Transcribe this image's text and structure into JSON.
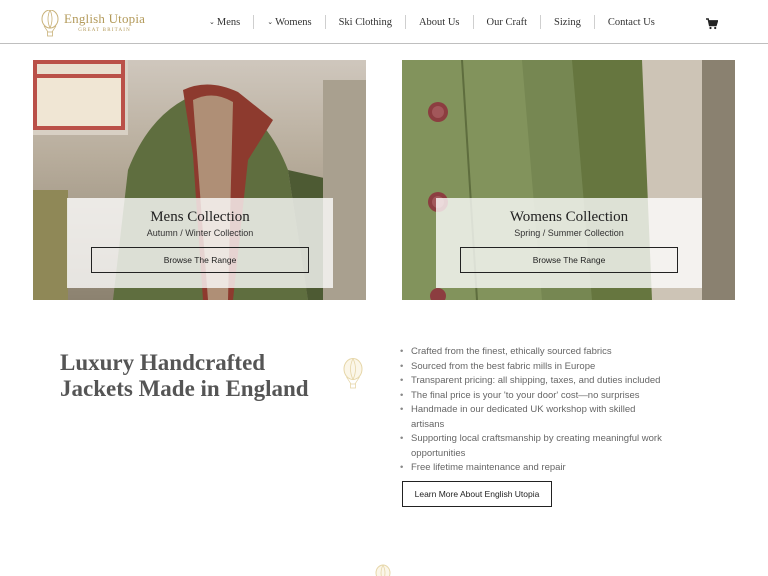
{
  "brand": {
    "name": "English Utopia",
    "tagline": "GREAT BRITAIN",
    "color": "#b39a5a"
  },
  "nav": {
    "items": [
      {
        "label": "Mens",
        "dropdown": true
      },
      {
        "label": "Womens",
        "dropdown": true
      },
      {
        "label": "Ski Clothing",
        "dropdown": false
      },
      {
        "label": "About Us",
        "dropdown": false
      },
      {
        "label": "Our Craft",
        "dropdown": false
      },
      {
        "label": "Sizing",
        "dropdown": false
      },
      {
        "label": "Contact Us",
        "dropdown": false
      }
    ],
    "cart_icon": "cart-icon"
  },
  "collections": [
    {
      "title": "Mens Collection",
      "subtitle": "Autumn / Winter Collection",
      "button": "Browse The Range"
    },
    {
      "title": "Womens Collection",
      "subtitle": "Spring / Summer Collection",
      "button": "Browse The Range"
    }
  ],
  "about": {
    "headline_line1": "Luxury Handcrafted",
    "headline_line2": "Jackets Made in England",
    "features": [
      "Crafted from the finest, ethically sourced fabrics",
      "Sourced from the best fabric mills in Europe",
      "Transparent pricing: all shipping, taxes, and duties included",
      "The final price is your 'to your door' cost—no surprises",
      "Handmade in our dedicated UK workshop with skilled artisans",
      "Supporting local craftsmanship by creating meaningful work opportunities",
      "Free lifetime maintenance and repair"
    ],
    "cta": "Learn More About English Utopia"
  }
}
